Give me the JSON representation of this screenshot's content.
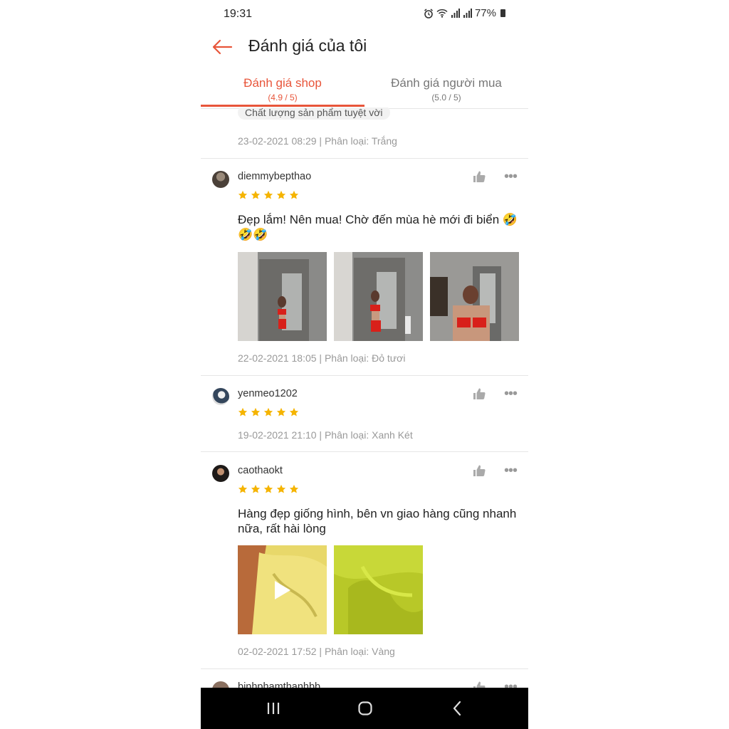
{
  "status_bar": {
    "time": "19:31",
    "battery": "77%"
  },
  "header": {
    "title": "Đánh giá của tôi"
  },
  "tabs": [
    {
      "label": "Đánh giá shop",
      "rating": "(4.9 / 5)"
    },
    {
      "label": "Đánh giá người mua",
      "rating": "(5.0 / 5)"
    }
  ],
  "colors": {
    "accent": "#e8553a",
    "star": "#f5b400",
    "muted": "#999999"
  },
  "partial_review": {
    "tag": "Chất lượng sản phẩm tuyệt vời",
    "meta": "23-02-2021 08:29 | Phân loại: Trắng"
  },
  "reviews": [
    {
      "username": "diemmybepthao",
      "rating": 5,
      "comment_line1": "Đẹp lắm! Nên mua! Chờ đến mùa hè mới đi biển 🤣",
      "comment_line2": "🤣🤣",
      "meta": "22-02-2021 18:05 | Phân loại: Đỏ tươi",
      "photo_count": 3
    },
    {
      "username": "yenmeo1202",
      "rating": 5,
      "meta": "19-02-2021 21:10 | Phân loại: Xanh Két"
    },
    {
      "username": "caothaokt",
      "rating": 5,
      "comment_line1": "Hàng đẹp giống hình, bên vn giao hàng cũng nhanh",
      "comment_line2": "nữa, rất hài lòng",
      "meta": "02-02-2021 17:52 | Phân loại: Vàng",
      "photo_count": 2,
      "first_is_video": true
    },
    {
      "username": "binhphamthanhbb"
    }
  ],
  "icons": {
    "back": "arrow-left-icon",
    "like": "thumbs-up-icon",
    "more": "more-dots-icon",
    "star": "star-icon",
    "play": "play-icon",
    "nav_recent": "recent-apps-icon",
    "nav_home": "home-icon",
    "nav_back": "chevron-left-icon"
  }
}
